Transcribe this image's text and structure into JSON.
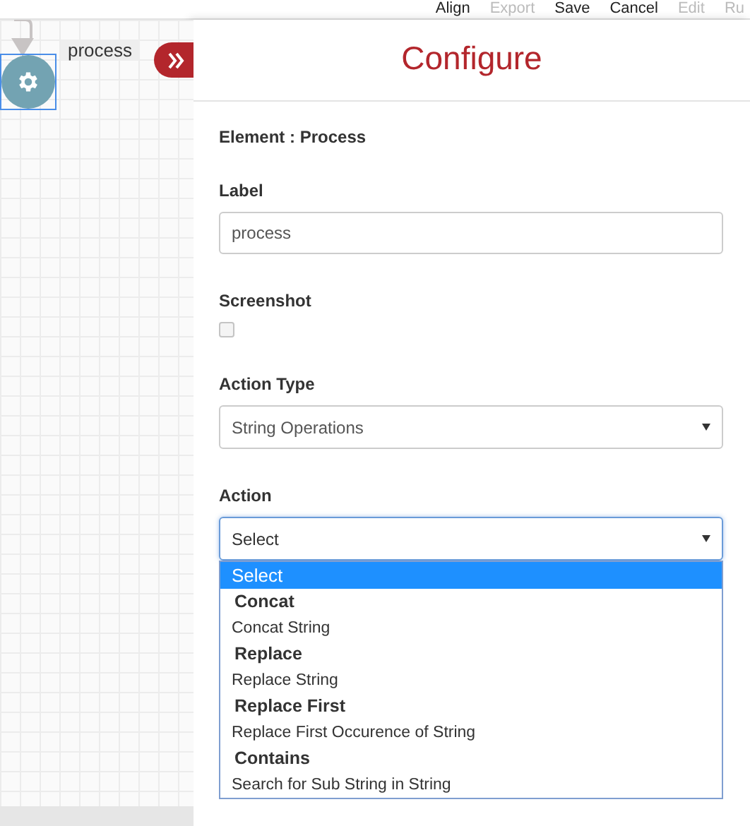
{
  "toolbar": [
    {
      "label": "Align",
      "disabled": false
    },
    {
      "label": "Export",
      "disabled": true
    },
    {
      "label": "Save",
      "disabled": false
    },
    {
      "label": "Cancel",
      "disabled": false
    },
    {
      "label": "Edit",
      "disabled": true
    },
    {
      "label": "Ru",
      "disabled": true
    }
  ],
  "canvas": {
    "node": {
      "label": "process",
      "selected": true
    }
  },
  "panel": {
    "title": "Configure",
    "element": "Element : Process",
    "fields": [
      {
        "kind": "text",
        "label": "Label",
        "value": "process"
      },
      {
        "kind": "checkbox",
        "label": "Screenshot",
        "checked": false
      },
      {
        "kind": "select",
        "label": "Action Type",
        "value": "String Operations",
        "open": false
      },
      {
        "kind": "select",
        "label": "Action",
        "value": "Select",
        "open": true,
        "options": [
          {
            "kind": "option",
            "label": "Select",
            "selected": true
          },
          {
            "kind": "group",
            "label": "Concat"
          },
          {
            "kind": "option",
            "label": "Concat String",
            "selected": false
          },
          {
            "kind": "group",
            "label": "Replace"
          },
          {
            "kind": "option",
            "label": "Replace String",
            "selected": false
          },
          {
            "kind": "group",
            "label": "Replace First"
          },
          {
            "kind": "option",
            "label": "Replace First Occurence of String",
            "selected": false
          },
          {
            "kind": "group",
            "label": "Contains"
          },
          {
            "kind": "option",
            "label": "Search for Sub String in String",
            "selected": false
          }
        ]
      }
    ]
  }
}
